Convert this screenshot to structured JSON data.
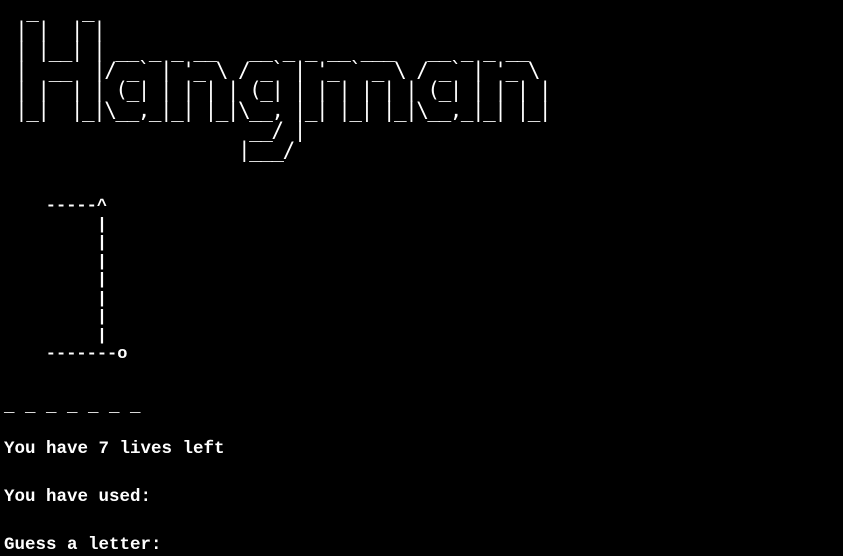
{
  "title_banner": "  _    _                                         \n | |  | |                                        \n | |__| | __ _ _ __   __ _ _ __ ___   __ _ _ __  \n |  __  |/ _` | '_ \\ / _` | '_ ` _ \\ / _` | '_ \\ \n | |  | | (_| | | | | (_| | | | | | | (_| | | | |\n |_|  |_|\\__,_|_| |_|\\__, |_| |_| |_|\\__,_|_| |_|\n                      __/ |                      \n                     |___/                       ",
  "gallows": "    -----^\n         |\n         |\n         |\n         |\n         |\n         |\n         |\n    -------o",
  "word_mask": "_ _ _ _ _ _ _",
  "lives_text": "You have 7 lives left",
  "used_text": "You have used:",
  "prompt_text": "Guess a letter:"
}
